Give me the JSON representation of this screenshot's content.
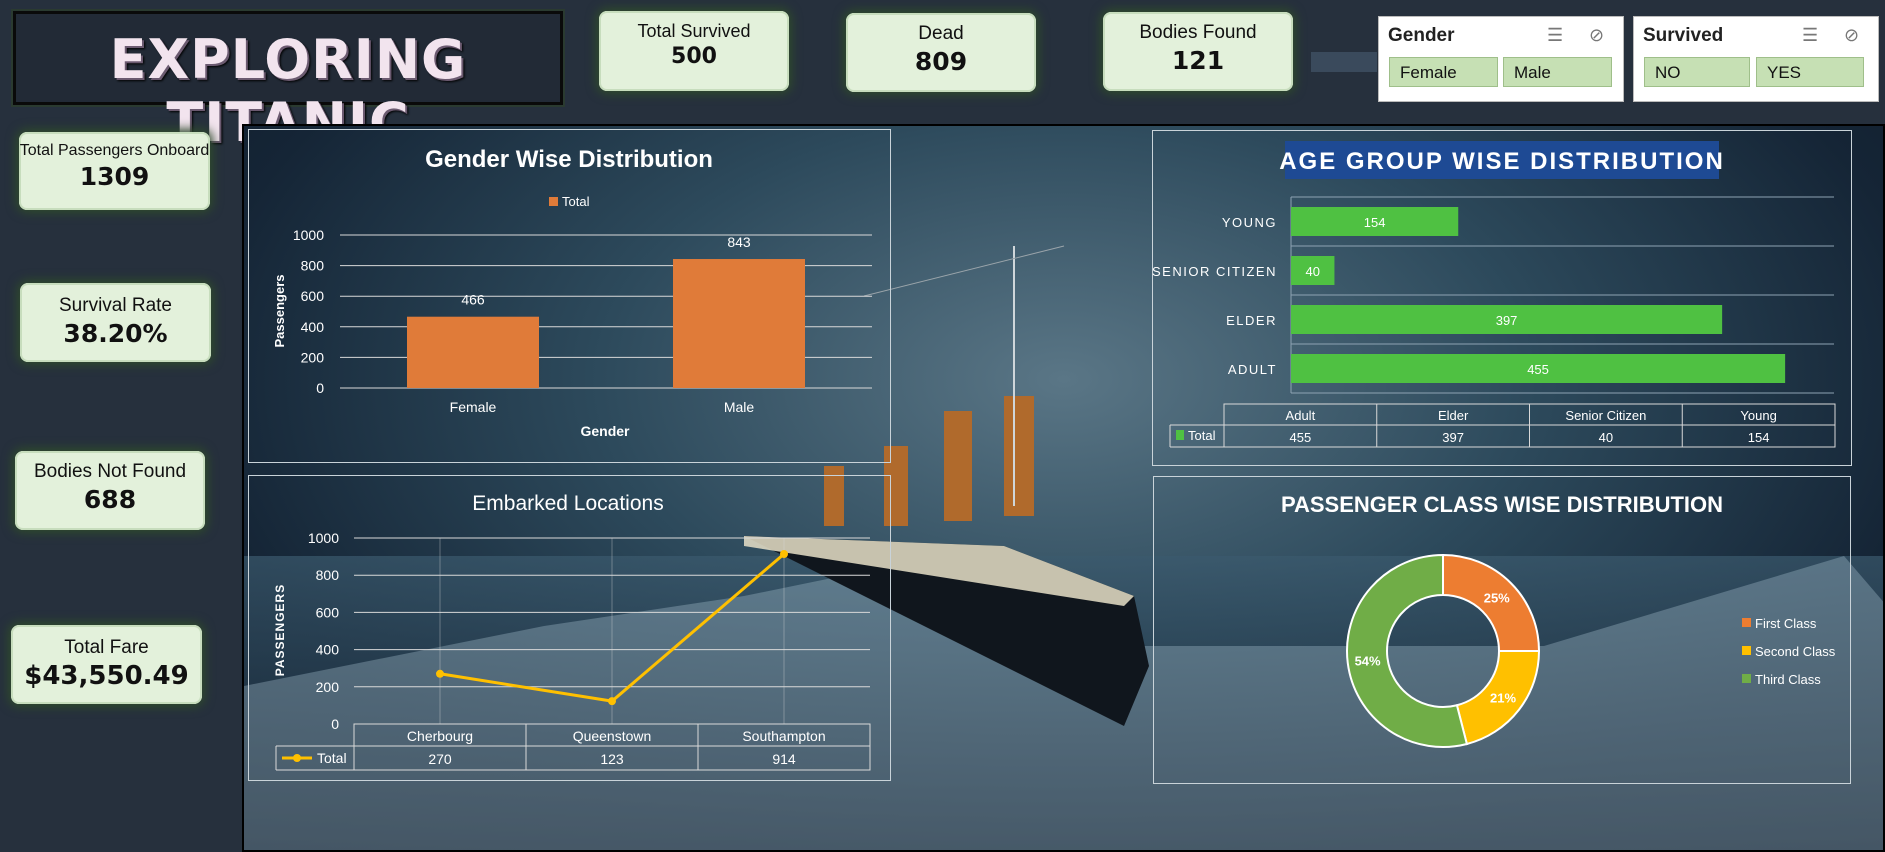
{
  "dashboard_title": "EXPLORING TITANIC",
  "kpis": {
    "total_survived": {
      "label": "Total Survived",
      "value": "500"
    },
    "dead": {
      "label": "Dead",
      "value": "809"
    },
    "bodies_found": {
      "label": "Bodies Found",
      "value": "121"
    },
    "total_passengers": {
      "label": "Total Passengers Onboard",
      "value": "1309"
    },
    "survival_rate": {
      "label": "Survival Rate",
      "value": "38.20%"
    },
    "bodies_not_found": {
      "label": "Bodies Not Found",
      "value": "688"
    },
    "total_fare": {
      "label": "Total Fare",
      "value": "$43,550.49"
    }
  },
  "slicers": {
    "gender": {
      "title": "Gender",
      "options": [
        "Female",
        "Male"
      ]
    },
    "survived": {
      "title": "Survived",
      "options": [
        "NO",
        "YES"
      ]
    },
    "icons": [
      "multi-select-icon",
      "clear-filter-icon"
    ]
  },
  "colors": {
    "orange": "#e07b39",
    "green": "#4fc142",
    "yellow": "#ffc000",
    "donut_orange": "#ed7d31",
    "donut_yellow": "#ffc000",
    "donut_green": "#70ad47"
  },
  "chart_data": [
    {
      "type": "bar",
      "title": "Gender Wise Distribution",
      "legend": "Total",
      "legend_position": "top",
      "categories": [
        "Female",
        "Male"
      ],
      "values": [
        466,
        843
      ],
      "xlabel": "Gender",
      "ylabel": "Passengers",
      "ylim": [
        0,
        1000
      ],
      "yticks": [
        0,
        200,
        400,
        600,
        800,
        1000
      ],
      "grid": true
    },
    {
      "type": "bar",
      "orientation": "horizontal",
      "title": "AGE GROUP WISE DISTRIBUTION",
      "categories": [
        "YOUNG",
        "SENIOR CITIZEN",
        "ELDER",
        "ADULT"
      ],
      "values": [
        154,
        40,
        397,
        455
      ],
      "xlim": [
        0,
        500
      ],
      "grid": true,
      "table": {
        "series_label": "Total",
        "columns": [
          "Adult",
          "Elder",
          "Senior Citizen",
          "Young"
        ],
        "values": [
          "455",
          "397",
          "40",
          "154"
        ]
      }
    },
    {
      "type": "line",
      "title": "Embarked Locations",
      "categories": [
        "Cherbourg",
        "Queenstown",
        "Southampton"
      ],
      "values": [
        270,
        123,
        914
      ],
      "ylabel": "PASSENGERS",
      "ylim": [
        0,
        1000
      ],
      "yticks": [
        0,
        200,
        400,
        600,
        800,
        1000
      ],
      "grid": true,
      "table": {
        "series_label": "Total",
        "values": [
          "270",
          "123",
          "914"
        ]
      }
    },
    {
      "type": "pie",
      "donut": true,
      "title": "PASSENGER CLASS WISE DISTRIBUTION",
      "legend_position": "right",
      "slices": [
        {
          "name": "First Class",
          "value": 25,
          "label": "25%"
        },
        {
          "name": "Second Class",
          "value": 21,
          "label": "21%"
        },
        {
          "name": "Third Class",
          "value": 54,
          "label": "54%"
        }
      ]
    }
  ]
}
